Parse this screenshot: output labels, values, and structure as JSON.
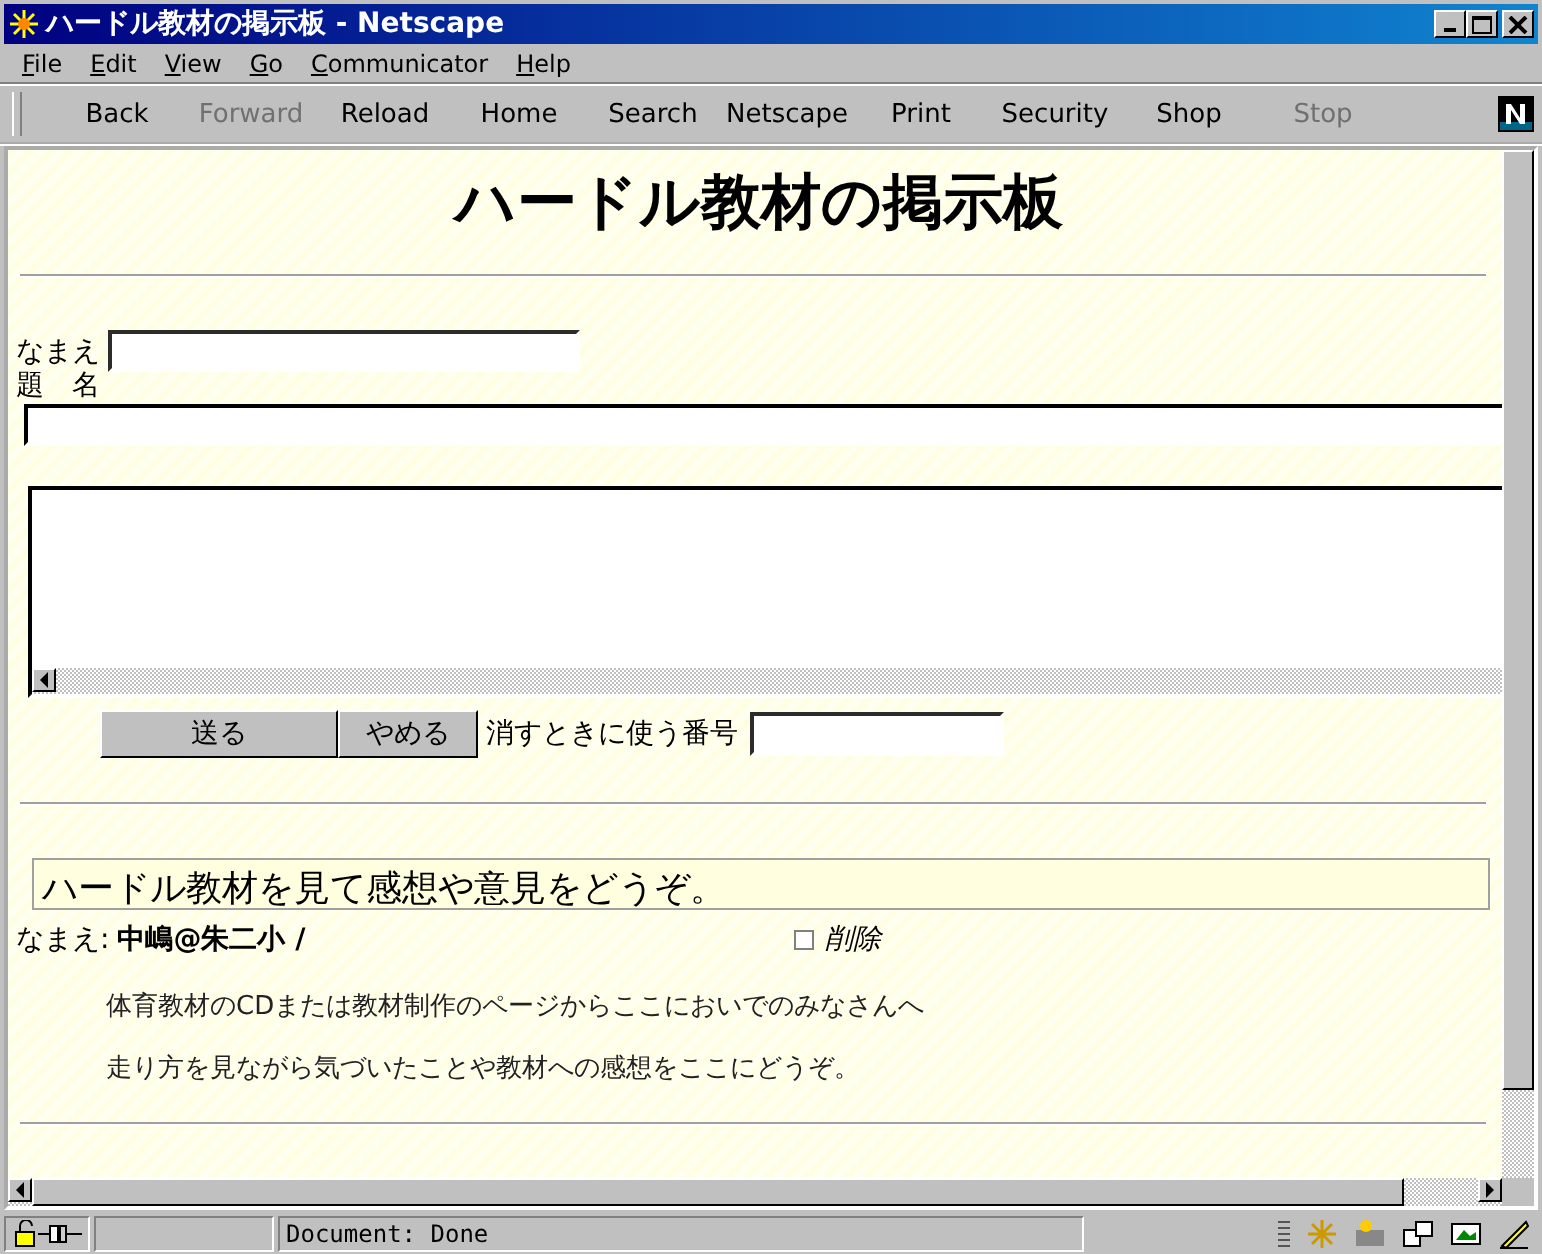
{
  "window": {
    "title": "ハードル教材の掲示板 - Netscape"
  },
  "menu": [
    {
      "label": "File"
    },
    {
      "label": "Edit"
    },
    {
      "label": "View"
    },
    {
      "label": "Go"
    },
    {
      "label": "Communicator"
    },
    {
      "label": "Help"
    }
  ],
  "toolbar": [
    {
      "label": "Back",
      "disabled": false
    },
    {
      "label": "Forward",
      "disabled": true
    },
    {
      "label": "Reload",
      "disabled": false
    },
    {
      "label": "Home",
      "disabled": false
    },
    {
      "label": "Search",
      "disabled": false
    },
    {
      "label": "Netscape",
      "disabled": false
    },
    {
      "label": "Print",
      "disabled": false
    },
    {
      "label": "Security",
      "disabled": false
    },
    {
      "label": "Shop",
      "disabled": false
    },
    {
      "label": "Stop",
      "disabled": true
    }
  ],
  "page": {
    "heading": "ハードル教材の掲示板",
    "form": {
      "name_label": "なまえ",
      "subject_label": "題　名",
      "submit": "送る",
      "reset": "やめる",
      "delete_key_label": "消すときに使う番号"
    },
    "posts": [
      {
        "subject": "ハードル教材を見て感想や意見をどうぞ。",
        "name_label": "なまえ:",
        "author": "中嶋@朱二小 /",
        "delete_label": "削除",
        "delete_checked": false,
        "lines": [
          "体育教材のCDまたは教材制作のページからここにおいでのみなさんへ",
          "走り方を見ながら気づいたことや教材への感想をここにどうぞ。"
        ]
      }
    ]
  },
  "status_bar": {
    "text": "Document: Done"
  }
}
